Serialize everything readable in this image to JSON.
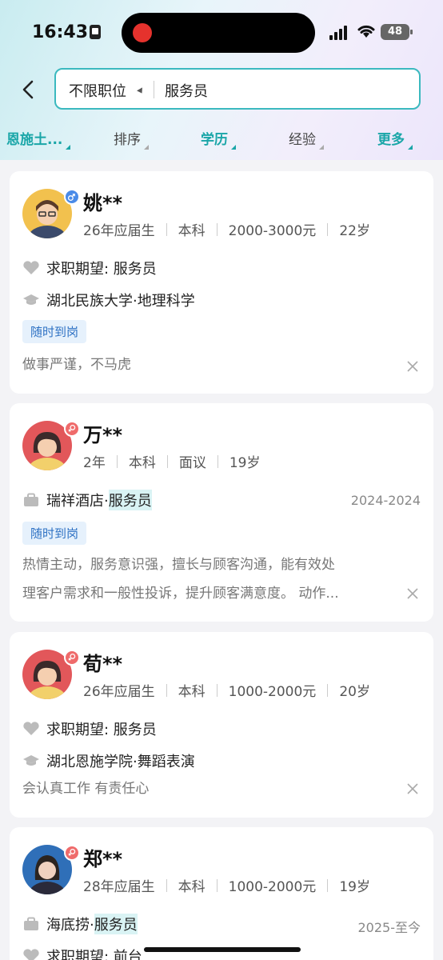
{
  "status_bar": {
    "time": "16:43",
    "battery": "48"
  },
  "search": {
    "position_filter": "不限职位",
    "query": "服务员"
  },
  "filters": [
    {
      "label": "恩施土...",
      "active": true
    },
    {
      "label": "排序",
      "active": false
    },
    {
      "label": "学历",
      "active": true
    },
    {
      "label": "经验",
      "active": false
    },
    {
      "label": "更多",
      "active": true
    }
  ],
  "candidates": [
    {
      "name": "姚**",
      "gender": "male",
      "meta": [
        "26年应届生",
        "本科",
        "2000-3000元",
        "22岁"
      ],
      "expectation": "求职期望: 服务员",
      "education": "湖北民族大学·地理科学",
      "tag": "随时到岗",
      "description": "做事严谨，不马虎"
    },
    {
      "name": "万**",
      "gender": "female",
      "meta": [
        "2年",
        "本科",
        "面议",
        "19岁"
      ],
      "work_company": "瑞祥酒店·",
      "work_role": "服务员",
      "work_period": "2024-2024",
      "tag": "随时到岗",
      "description_line1": "热情主动，服务意识强，擅长与顾客沟通，能有效处",
      "description_line2": "理客户需求和一般性投诉，提升顾客满意度。 动作..."
    },
    {
      "name": "荀**",
      "gender": "female",
      "meta": [
        "26年应届生",
        "本科",
        "1000-2000元",
        "20岁"
      ],
      "expectation": "求职期望: 服务员",
      "education": "湖北恩施学院·舞蹈表演",
      "description": "会认真工作 有责任心"
    },
    {
      "name": "郑**",
      "gender": "female",
      "meta": [
        "28年应届生",
        "本科",
        "1000-2000元",
        "19岁"
      ],
      "work_company": "海底捞·",
      "work_role": "服务员",
      "work_period": "2025-至今",
      "expectation": "求职期望: 前台"
    }
  ]
}
